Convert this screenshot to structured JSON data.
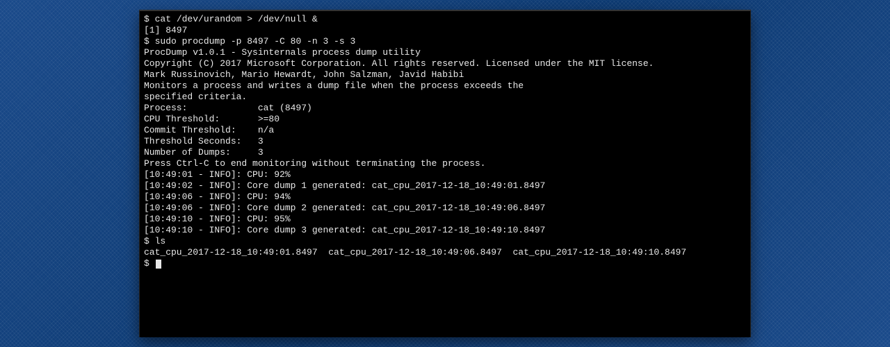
{
  "terminal": {
    "prompt": "$ ",
    "lines": {
      "cmd1": "cat /dev/urandom > /dev/null &",
      "job1": "[1] 8497",
      "cmd2": "sudo procdump -p 8497 -C 80 -n 3 -s 3",
      "blank1": "",
      "header1": "ProcDump v1.0.1 - Sysinternals process dump utility",
      "header2": "Copyright (C) 2017 Microsoft Corporation. All rights reserved. Licensed under the MIT license.",
      "header3": "Mark Russinovich, Mario Hewardt, John Salzman, Javid Habibi",
      "header4": "Monitors a process and writes a dump file when the process exceeds the",
      "header5": "specified criteria.",
      "blank2": "",
      "info_process": "Process:             cat (8497)",
      "info_cputhresh": "CPU Threshold:       >=80",
      "info_committhresh": "Commit Threshold:    n/a",
      "info_threshsec": "Threshold Seconds:   3",
      "info_numdumps": "Number of Dumps:     3",
      "blank3": "",
      "press_ctrlc": "Press Ctrl-C to end monitoring without terminating the process.",
      "blank4": "",
      "log1": "[10:49:01 - INFO]: CPU: 92%",
      "log2": "[10:49:02 - INFO]: Core dump 1 generated: cat_cpu_2017-12-18_10:49:01.8497",
      "log3": "[10:49:06 - INFO]: CPU: 94%",
      "log4": "[10:49:06 - INFO]: Core dump 2 generated: cat_cpu_2017-12-18_10:49:06.8497",
      "log5": "[10:49:10 - INFO]: CPU: 95%",
      "log6": "[10:49:10 - INFO]: Core dump 3 generated: cat_cpu_2017-12-18_10:49:10.8497",
      "cmd3": "ls",
      "ls_output": "cat_cpu_2017-12-18_10:49:01.8497  cat_cpu_2017-12-18_10:49:06.8497  cat_cpu_2017-12-18_10:49:10.8497"
    }
  },
  "colors": {
    "bg_desktop": "#0d3a72",
    "bg_terminal": "#000000",
    "fg_terminal": "#e8e8e8"
  }
}
